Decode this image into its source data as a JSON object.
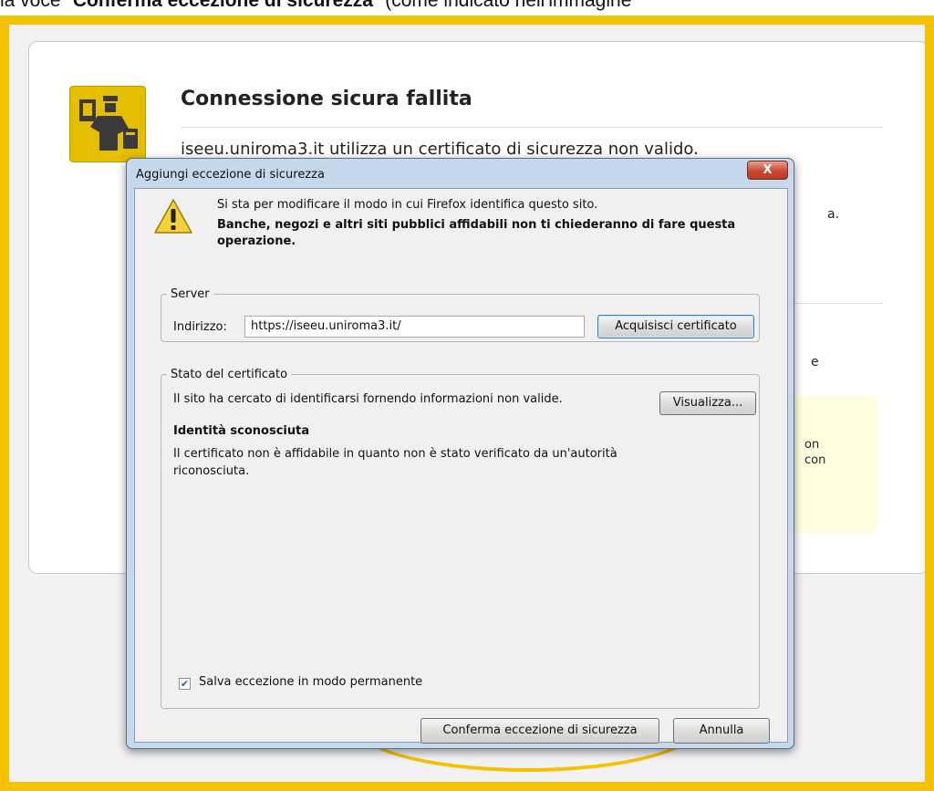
{
  "caption": {
    "prefix": "la voce \"",
    "bold": "Conferma eccezione di sicurezza",
    "suffix": "\" (come indicato nell'immagine"
  },
  "error_page": {
    "title": "Connessione sicura fallita",
    "description": "iseeu.uniroma3.it utilizza un certificato di sicurezza non valido.",
    "frag_a": "a.",
    "frag_e": "e",
    "frag_on": "on",
    "frag_con": "con"
  },
  "dialog": {
    "title": "Aggiungi eccezione di sicurezza",
    "close_label": "X",
    "warning_line1": "Si sta per modificare il modo in cui Firefox identifica questo sito.",
    "warning_line2": "Banche, negozi e altri siti pubblici affidabili non ti chiederanno di fare questa operazione.",
    "server_legend": "Server",
    "address_label": "Indirizzo:",
    "address_value": "https://iseeu.uniroma3.it/",
    "get_cert_button": "Acquisisci certificato",
    "status_legend": "Stato del certificato",
    "status_message": "Il sito ha cercato di identificarsi fornendo informazioni non valide.",
    "view_button": "Visualizza...",
    "identity_heading": "Identità sconosciuta",
    "identity_text": "Il certificato non è affidabile in quanto non è stato verificato da un'autorità riconosciuta.",
    "permanent_checkbox_label": "Salva eccezione in modo permanente",
    "permanent_checked": true,
    "confirm_button": "Conferma eccezione di sicurezza",
    "cancel_button": "Annulla"
  },
  "colors": {
    "highlight": "#f5c200",
    "error_icon": "#e6be00"
  }
}
